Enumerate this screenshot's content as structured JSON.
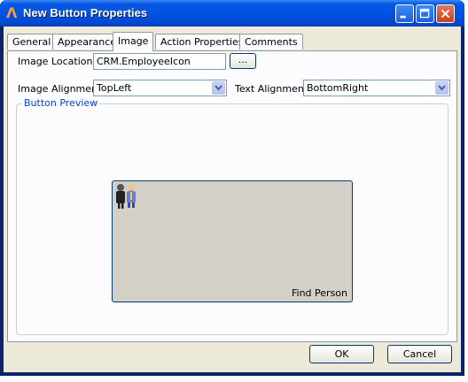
{
  "window": {
    "title": "New Button Properties"
  },
  "tabs": [
    {
      "label": "General"
    },
    {
      "label": "Appearance"
    },
    {
      "label": "Image",
      "active": true
    },
    {
      "label": "Action Properties"
    },
    {
      "label": "Comments"
    }
  ],
  "image_location": {
    "label": "Image Location",
    "value": "CRM.EmployeeIcon",
    "browse_label": "..."
  },
  "image_alignment": {
    "label": "Image Alignment",
    "value": "TopLeft"
  },
  "text_alignment": {
    "label": "Text Alignment",
    "value": "BottomRight"
  },
  "preview": {
    "group_title": "Button Preview",
    "button_text": "Find Person",
    "icon": "employee-icon"
  },
  "buttons": {
    "ok_label": "OK",
    "cancel_label": "Cancel"
  },
  "colors": {
    "titlebar": "#0054e3",
    "client": "#ece9d8",
    "group_title": "#0046d5",
    "preview_face": "#d4d0c8"
  }
}
